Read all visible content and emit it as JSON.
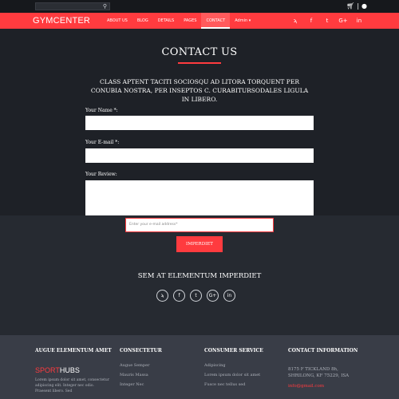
{
  "topbar": {
    "search_placeholder": "",
    "search_icon": "search-icon",
    "cart_icon": "cart-icon",
    "separator": "|",
    "user_icon": "user-icon"
  },
  "brand": {
    "logo": "GYMCENTER"
  },
  "nav": {
    "items": [
      {
        "label": "ABOUT US"
      },
      {
        "label": "BLOG"
      },
      {
        "label": "DETAILS"
      },
      {
        "label": "PAGES"
      },
      {
        "label": "CONTACT",
        "active": true
      },
      {
        "label": "Admin ▾"
      }
    ],
    "social": [
      "rss-icon",
      "facebook-icon",
      "twitter-icon",
      "google-plus-icon",
      "linkedin-icon"
    ],
    "social_glyphs": [
      "ϡ",
      "f",
      "t",
      "G+",
      "in"
    ]
  },
  "contact": {
    "title": "CONTACT US",
    "intro": "CLASS APTENT TACITI SOCIOSQU AD LITORA TORQUENT PER CONUBIA NOSTRA, PER INSEPTOS C. CURABITURSODALES LIGULA IN LIBERO.",
    "name_label": "Your Name *:",
    "email_label": "Your E-mail *:",
    "review_label": "Your Review:"
  },
  "subscribe": {
    "placeholder": "Enter your e-mail address*",
    "button": "IMPERDIET"
  },
  "social": {
    "title": "SEM AT ELEMENTUM IMPERDIET",
    "icons": [
      "rss-icon",
      "facebook-icon",
      "twitter-icon",
      "google-plus-icon",
      "linkedin-icon"
    ],
    "glyphs": [
      "ϡ",
      "f",
      "t",
      "G+",
      "in"
    ]
  },
  "footer": {
    "col1": {
      "heading": "AUGUE ELEMENTUM AMET",
      "brand_sport": "SPORT",
      "brand_hubs": "HUBS",
      "text": "Lorem ipsum dolor sit amet, consectetur adipiscing elit. Integer nec odio. Praesent libero. Sed"
    },
    "col2": {
      "heading": "CONSECTETUR",
      "links": [
        "Augue Semper",
        "Mauris Massa",
        "Integer Nec"
      ]
    },
    "col3": {
      "heading": "CONSUMER SERVICE",
      "links": [
        "Adipiscing",
        "Lorem ipsum dolor sit amet",
        "Fusce nec tellus sed"
      ]
    },
    "col4": {
      "heading": "CONTACT INFORMATION",
      "address1": "8175 F TICKLAND 8h,",
      "address2": "SHRILONG, KF 75229, ISA",
      "email": "info@gmail.com"
    }
  },
  "colors": {
    "accent": "#ff3b3f",
    "background": "#1e2127",
    "footer": "#393d47"
  }
}
